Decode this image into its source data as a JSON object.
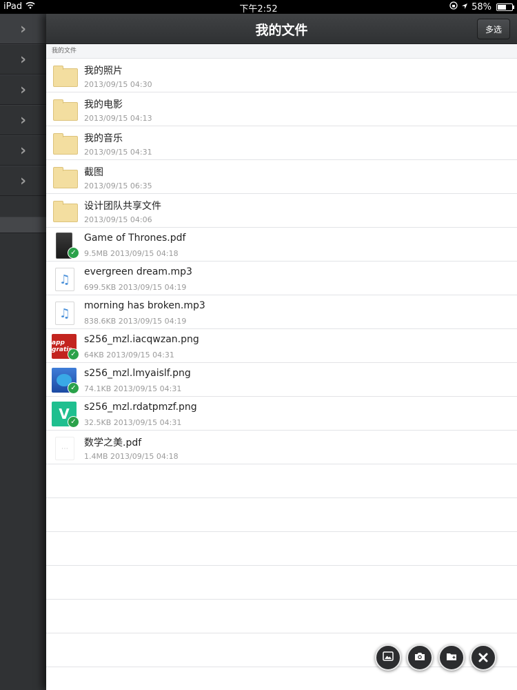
{
  "status_bar": {
    "device": "iPad",
    "time": "下午2:52",
    "battery": "58%",
    "battery_level": 0.58
  },
  "nav": {
    "title": "我的文件",
    "multi_select_label": "多选"
  },
  "breadcrumb": "我的文件",
  "files": [
    {
      "name": "我的照片",
      "meta": "2013/09/15 04:30",
      "kind": "folder"
    },
    {
      "name": "我的电影",
      "meta": "2013/09/15 04:13",
      "kind": "folder"
    },
    {
      "name": "我的音乐",
      "meta": "2013/09/15 04:31",
      "kind": "folder"
    },
    {
      "name": "截图",
      "meta": "2013/09/15 06:35",
      "kind": "folder"
    },
    {
      "name": "设计团队共享文件",
      "meta": "2013/09/15 04:06",
      "kind": "folder"
    },
    {
      "name": "Game of Thrones.pdf",
      "meta": "9.5MB 2013/09/15 04:18",
      "kind": "book-pdf",
      "synced": true
    },
    {
      "name": "evergreen dream.mp3",
      "meta": "699.5KB 2013/09/15 04:19",
      "kind": "music"
    },
    {
      "name": "morning has broken.mp3",
      "meta": "838.6KB 2013/09/15 04:19",
      "kind": "music"
    },
    {
      "name": "s256_mzl.iacqwzan.png",
      "meta": "64KB 2013/09/15 04:31",
      "kind": "image-red",
      "synced": true
    },
    {
      "name": "s256_mzl.lmyaislf.png",
      "meta": "74.1KB 2013/09/15 04:31",
      "kind": "image-blue",
      "synced": true
    },
    {
      "name": "s256_mzl.rdatpmzf.png",
      "meta": "32.5KB 2013/09/15 04:31",
      "kind": "image-green",
      "synced": true
    },
    {
      "name": "数学之美.pdf",
      "meta": "1.4MB 2013/09/15 04:18",
      "kind": "blank-pdf"
    }
  ],
  "thumb_labels": {
    "image-red": "app gratis",
    "image-green": "V"
  },
  "actions": [
    "upload-photo",
    "camera",
    "new-folder",
    "close"
  ]
}
